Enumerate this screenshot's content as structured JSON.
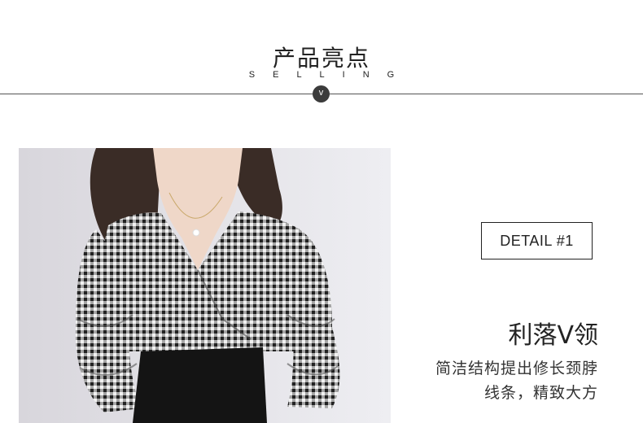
{
  "section": {
    "title": "产品亮点",
    "subtitle": "SELLING",
    "badge_icon": "chevron-down-icon",
    "badge_glyph": "v"
  },
  "product_image": {
    "subject": "model-wearing-gingham-v-neck-blouse"
  },
  "detail": {
    "tag": "DETAIL #1",
    "title": "利落V领",
    "description_lines": [
      "简洁结构提出修长颈脖",
      "线条，精致大方"
    ]
  },
  "colors": {
    "accent": "#3b3b3b",
    "text": "#222222",
    "background": "#ffffff"
  }
}
